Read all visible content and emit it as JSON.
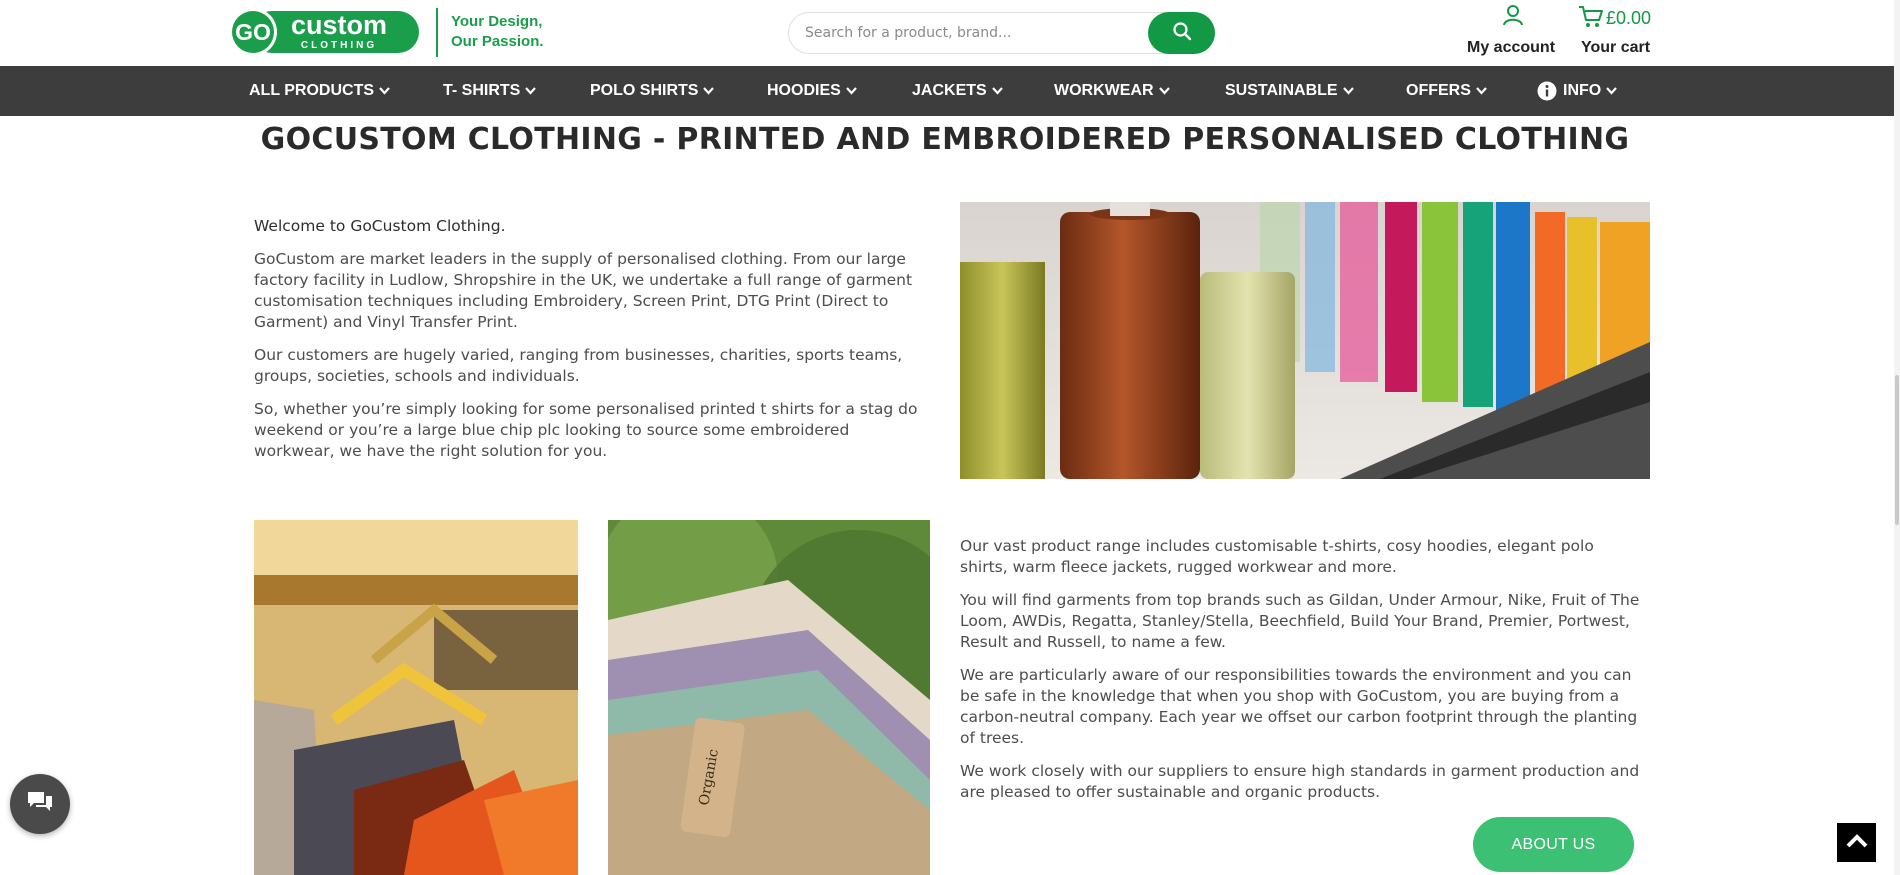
{
  "brand": {
    "logo_top": "GO custom",
    "logo_bottom": "CLOTHING",
    "tagline_line1": "Your Design,",
    "tagline_line2": "Our Passion.",
    "color": "#1a9e4b"
  },
  "search": {
    "placeholder": "Search for a product, brand..."
  },
  "account": {
    "label": "My account",
    "icon": "user-icon"
  },
  "cart": {
    "amount": "£0.00",
    "label": "Your cart",
    "icon": "cart-icon"
  },
  "nav": {
    "items": [
      {
        "label": "ALL PRODUCTS"
      },
      {
        "label": "T- SHIRTS"
      },
      {
        "label": "POLO SHIRTS"
      },
      {
        "label": "HOODIES"
      },
      {
        "label": "JACKETS"
      },
      {
        "label": "WORKWEAR"
      },
      {
        "label": "SUSTAINABLE"
      },
      {
        "label": "OFFERS"
      },
      {
        "label": "INFO"
      }
    ]
  },
  "main": {
    "title": "GOCUSTOM CLOTHING - PRINTED AND EMBROIDERED PERSONALISED CLOTHING",
    "welcome": "Welcome to GoCustom Clothing.",
    "para1": "GoCustom are market leaders in the supply of personalised clothing. From our large factory facility in Ludlow, Shropshire in the UK, we undertake a full range of garment customisation techniques including Embroidery, Screen Print, DTG Print (Direct to Garment) and Vinyl Transfer Print.",
    "para2": "Our customers are hugely varied, ranging from businesses, charities, sports teams, groups, societies, schools and individuals.",
    "para3": "So, whether you’re simply looking for some personalised printed t shirts for a stag do weekend or you’re a large blue chip plc looking to source some embroidered workwear, we have the right solution for you.",
    "para4": "Our vast product range includes customisable t-shirts, cosy hoodies, elegant polo shirts, warm fleece jackets, rugged workwear and more.",
    "para5": "You will find garments from top brands such as Gildan, Under Armour, Nike, Fruit of The Loom, AWDis, Regatta, Stanley/Stella, Beechfield, Build Your Brand, Premier, Portwest, Result and Russell, to name a few.",
    "para6": "We are particularly aware of our responsibilities towards the environment and you can be safe in the knowledge that when you shop with GoCustom, you are buying from a carbon-neutral company. Each year we offset our carbon footprint through the planting of trees.",
    "para7": "We work closely with our suppliers to ensure high standards in garment production and are pleased to offer sustainable and organic products.",
    "about_button": "ABOUT US",
    "organic_tag": "Organic"
  },
  "colors": {
    "green": "#119945",
    "nav_bg": "#3d3d3d",
    "about_btn": "#3cc074"
  }
}
